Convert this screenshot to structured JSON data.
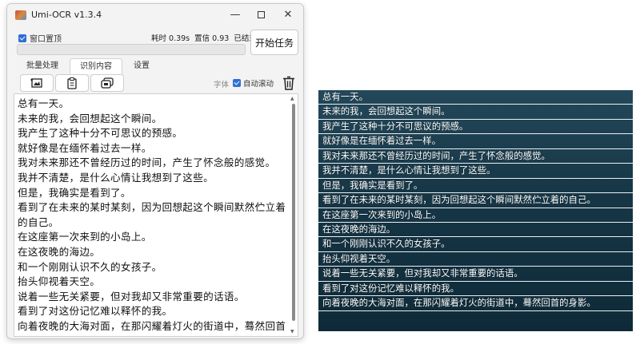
{
  "window": {
    "title": "Umi-OCR v1.3.4",
    "controls": {
      "minimize": "—",
      "close": "✕"
    }
  },
  "topbar": {
    "pin_label": "窗口置顶",
    "time_stat": "耗时 0.39s",
    "confidence_stat": "置信 0.93",
    "status": "已结束",
    "start_button": "开始任务"
  },
  "tabs": [
    {
      "label": "批量处理",
      "active": false
    },
    {
      "label": "识别内容",
      "active": true
    },
    {
      "label": "设置",
      "active": false
    }
  ],
  "toolbar": {
    "font_label": "字体",
    "autoscroll_label": "自动滚动",
    "icons": [
      "screenshot-icon",
      "clipboard-icon",
      "copy-icon",
      "trash-icon"
    ]
  },
  "ocr_text": [
    "总有一天。",
    "未来的我，会回想起这个瞬间。",
    "我产生了这种十分不可思议的预感。",
    "就好像是在缅怀着过去一样。",
    "我对未来那还不曾经历过的时间，产生了怀念般的感觉。",
    "我并不清楚，是什么心情让我想到了这些。",
    "但是，我确实是看到了。",
    "看到了在未来的某时某刻，因为回想起这个瞬间默然伫立着的自己。",
    "在这座第一次来到的小岛上。",
    "在这夜晚的海边。",
    "和一个刚刚认识不久的女孩子。",
    "抬头仰视着天空。",
    "说着一些无关紧要，但对我却又非常重要的话语。",
    "看到了对这份记忆难以释怀的我。",
    "向着夜晚的大海对面，在那闪耀着灯火的街道中，蓦然回首的身影。"
  ],
  "subtitles": [
    "总有一天。",
    "未来的我，会回想起这个瞬间。",
    "我产生了这种十分不可思议的预感。",
    "就好像是在缅怀着过去一样。",
    "我对未来那还不曾经历过的时间，产生了怀念般的感觉。",
    "我并不清楚，是什么心情让我想到了这些。",
    "但是，我确实是看到了。",
    "看到了在未来的某时某刻，因为回想起这个瞬间默然伫立着的自己。",
    "在这座第一次来到的小岛上。",
    "在这夜晚的海边。",
    "和一个刚刚认识不久的女孩子。",
    "抬头仰视着天空。",
    "说着一些无关紧要，但对我却又非常重要的话语。",
    "看到了对这份记忆难以释怀的我。",
    "向着夜晚的大海对面，在那闪耀着灯火的街道中，蓦然回首的身影。"
  ],
  "colors": {
    "accent": "#2f6fd6",
    "subtitle_bg": "#163646"
  }
}
